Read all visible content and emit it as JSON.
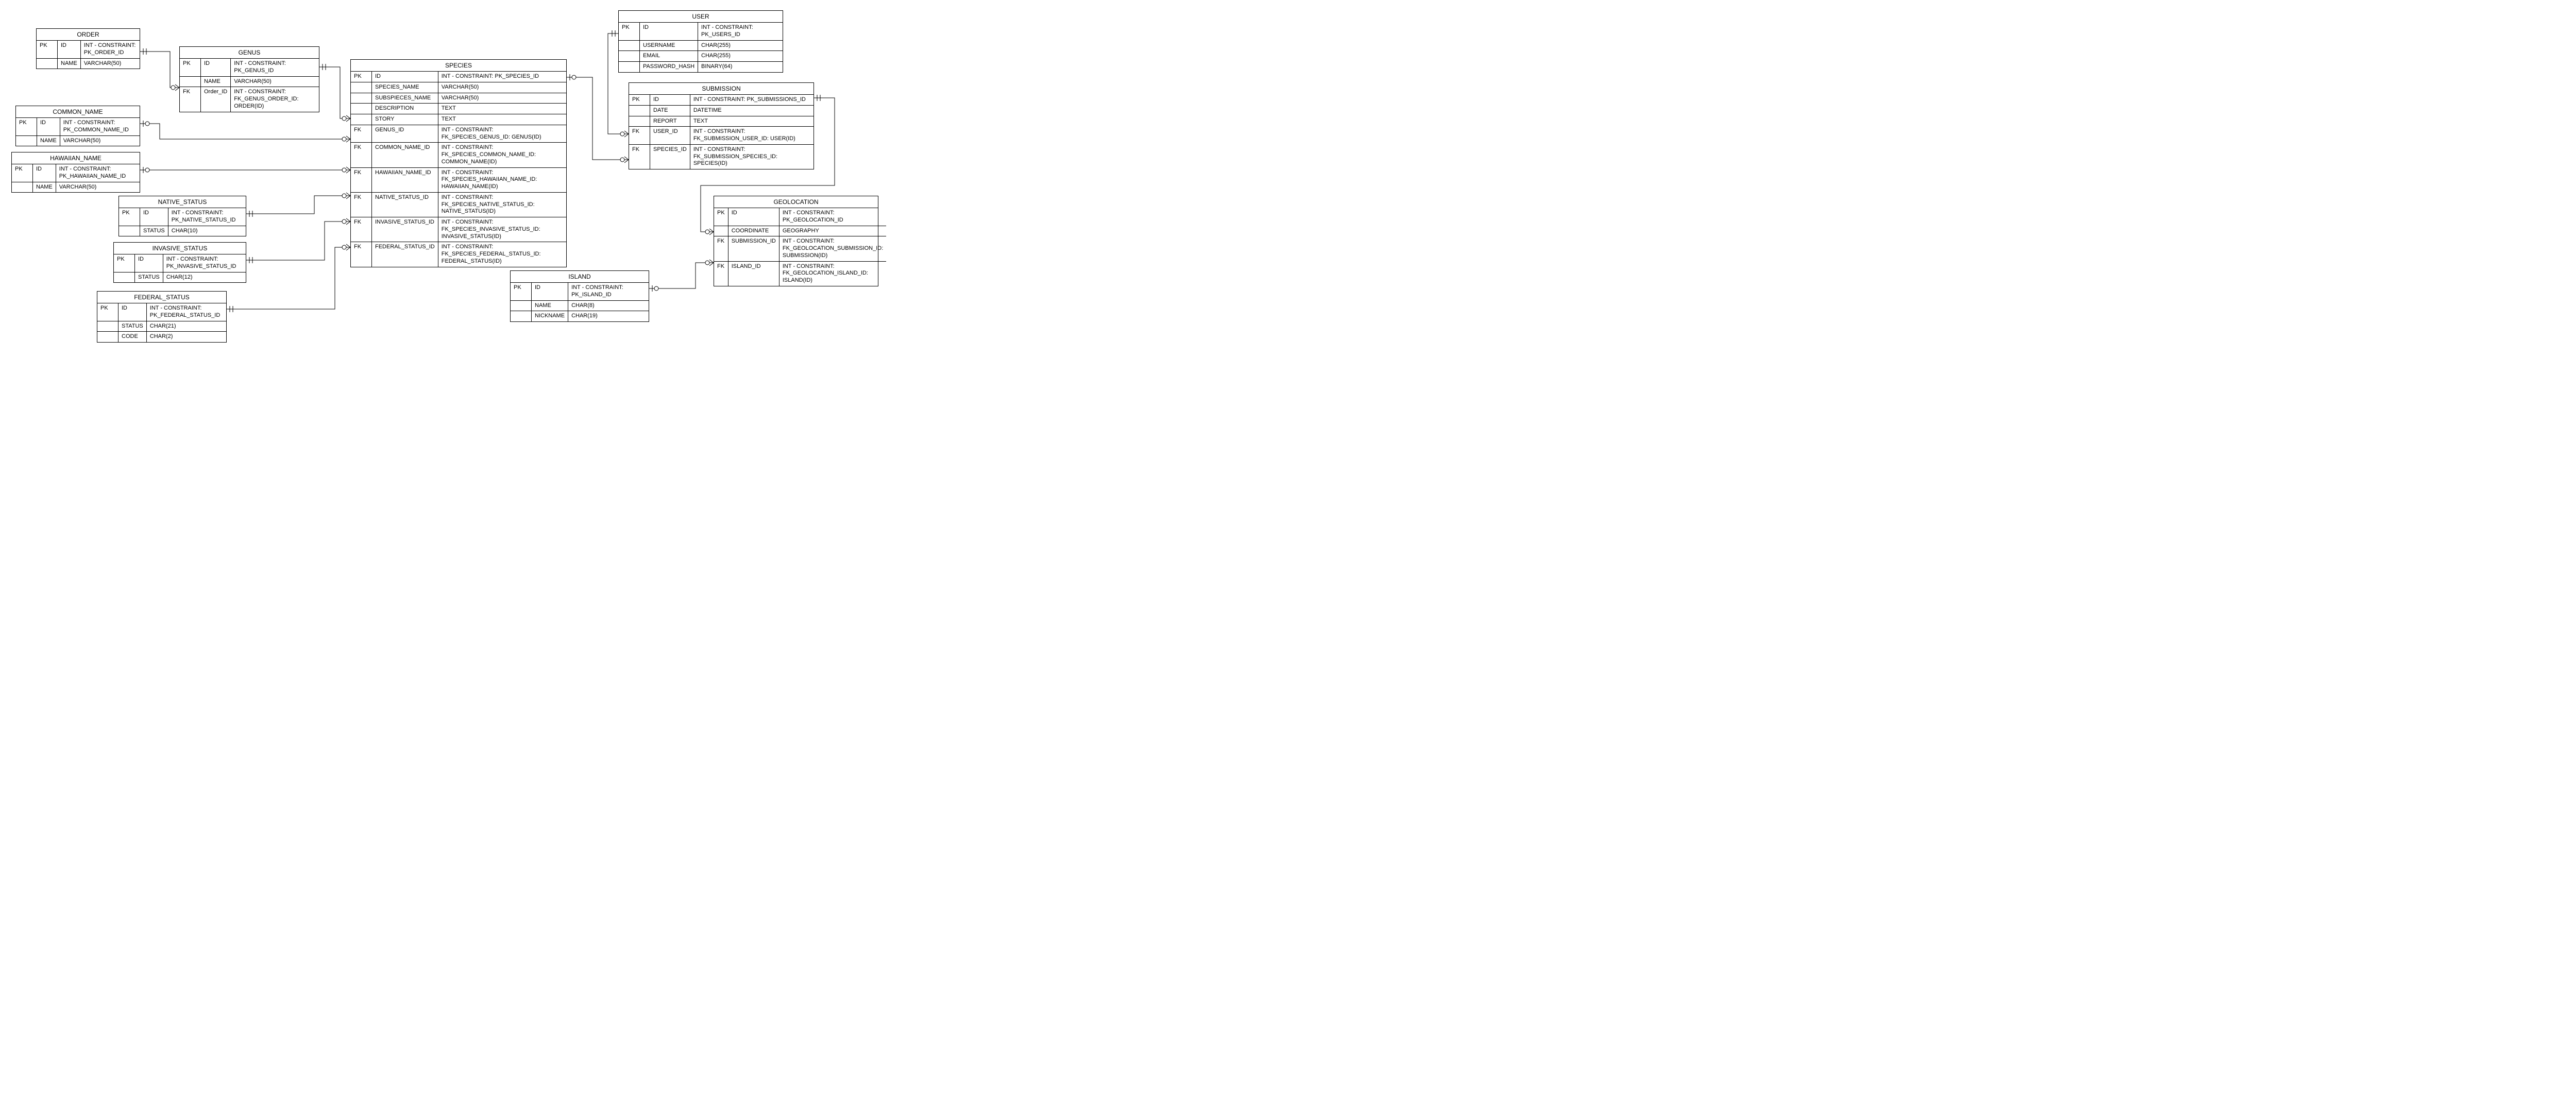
{
  "entities": {
    "order": {
      "title": "ORDER",
      "rows": [
        {
          "key": "PK",
          "name": "ID",
          "type": "INT - CONSTRAINT: PK_ORDER_ID"
        },
        {
          "key": "",
          "name": "NAME",
          "type": "VARCHAR(50)"
        }
      ]
    },
    "genus": {
      "title": "GENUS",
      "rows": [
        {
          "key": "PK",
          "name": "ID",
          "type": "INT - CONSTRAINT: PK_GENUS_ID"
        },
        {
          "key": "",
          "name": "NAME",
          "type": "VARCHAR(50)"
        },
        {
          "key": "FK",
          "name": "Order_ID",
          "type": "INT - CONSTRAINT: FK_GENUS_ORDER_ID: ORDER(ID)"
        }
      ]
    },
    "common_name": {
      "title": "COMMON_NAME",
      "rows": [
        {
          "key": "PK",
          "name": "ID",
          "type": "INT - CONSTRAINT: PK_COMMON_NAME_ID"
        },
        {
          "key": "",
          "name": "NAME",
          "type": "VARCHAR(50)"
        }
      ]
    },
    "hawaiian_name": {
      "title": "HAWAIIAN_NAME",
      "rows": [
        {
          "key": "PK",
          "name": "ID",
          "type": "INT - CONSTRAINT: PK_HAWAIIAN_NAME_ID"
        },
        {
          "key": "",
          "name": "NAME",
          "type": "VARCHAR(50)"
        }
      ]
    },
    "native_status": {
      "title": "NATIVE_STATUS",
      "rows": [
        {
          "key": "PK",
          "name": "ID",
          "type": "INT - CONSTRAINT: PK_NATIVE_STATUS_ID"
        },
        {
          "key": "",
          "name": "STATUS",
          "type": "CHAR(10)"
        }
      ]
    },
    "invasive_status": {
      "title": "INVASIVE_STATUS",
      "rows": [
        {
          "key": "PK",
          "name": "ID",
          "type": "INT - CONSTRAINT: PK_INVASIVE_STATUS_ID"
        },
        {
          "key": "",
          "name": "STATUS",
          "type": "CHAR(12)"
        }
      ]
    },
    "federal_status": {
      "title": "FEDERAL_STATUS",
      "rows": [
        {
          "key": "PK",
          "name": "ID",
          "type": "INT - CONSTRAINT: PK_FEDERAL_STATUS_ID"
        },
        {
          "key": "",
          "name": "STATUS",
          "type": "CHAR(21)"
        },
        {
          "key": "",
          "name": "CODE",
          "type": "CHAR(2)"
        }
      ]
    },
    "species": {
      "title": "SPECIES",
      "rows": [
        {
          "key": "PK",
          "name": "ID",
          "type": "INT - CONSTRAINT: PK_SPECIES_ID"
        },
        {
          "key": "",
          "name": "SPECIES_NAME",
          "type": "VARCHAR(50)"
        },
        {
          "key": "",
          "name": "SUBSPIECES_NAME",
          "type": "VARCHAR(50)"
        },
        {
          "key": "",
          "name": "DESCRIPTION",
          "type": "TEXT"
        },
        {
          "key": "",
          "name": "STORY",
          "type": "TEXT"
        },
        {
          "key": "FK",
          "name": "GENUS_ID",
          "type": "INT - CONSTRAINT: FK_SPECIES_GENUS_ID: GENUS(ID)"
        },
        {
          "key": "FK",
          "name": "COMMON_NAME_ID",
          "type": "INT - CONSTRAINT: FK_SPECIES_COMMON_NAME_ID: COMMON_NAME(ID)"
        },
        {
          "key": "FK",
          "name": "HAWAIIAN_NAME_ID",
          "type": "INT - CONSTRAINT: FK_SPECIES_HAWAIIAN_NAME_ID: HAWAIIAN_NAME(ID)"
        },
        {
          "key": "FK",
          "name": "NATIVE_STATUS_ID",
          "type": "INT - CONSTRAINT: FK_SPECIES_NATIVE_STATUS_ID: NATIVE_STATUS(ID)"
        },
        {
          "key": "FK",
          "name": "INVASIVE_STATUS_ID",
          "type": "INT - CONSTRAINT: FK_SPECIES_INVASIVE_STATUS_ID: INVASIVE_STATUS(ID)"
        },
        {
          "key": "FK",
          "name": "FEDERAL_STATUS_ID",
          "type": "INT - CONSTRAINT: FK_SPECIES_FEDERAL_STATUS_ID: FEDERAL_STATUS(ID)"
        }
      ]
    },
    "user": {
      "title": "USER",
      "rows": [
        {
          "key": "PK",
          "name": "ID",
          "type": "INT - CONSTRAINT: PK_USERS_ID"
        },
        {
          "key": "",
          "name": "USERNAME",
          "type": "CHAR(255)"
        },
        {
          "key": "",
          "name": "EMAIL",
          "type": "CHAR(255)"
        },
        {
          "key": "",
          "name": "PASSWORD_HASH",
          "type": "BINARY(64)"
        }
      ]
    },
    "submission": {
      "title": "SUBMISSION",
      "rows": [
        {
          "key": "PK",
          "name": "ID",
          "type": "INT - CONSTRAINT: PK_SUBMISSIONS_ID"
        },
        {
          "key": "",
          "name": "DATE",
          "type": "DATETIME"
        },
        {
          "key": "",
          "name": "REPORT",
          "type": "TEXT"
        },
        {
          "key": "FK",
          "name": "USER_ID",
          "type": "INT - CONSTRAINT: FK_SUBMISSION_USER_ID: USER(ID)"
        },
        {
          "key": "FK",
          "name": "SPECIES_ID",
          "type": "INT - CONSTRAINT: FK_SUBMISSION_SPECIES_ID: SPECIES(ID)"
        }
      ]
    },
    "geolocation": {
      "title": "GEOLOCATION",
      "rows": [
        {
          "key": "PK",
          "name": "ID",
          "type": "INT - CONSTRAINT: PK_GEOLOCATION_ID"
        },
        {
          "key": "",
          "name": "COORDINATE",
          "type": "GEOGRAPHY"
        },
        {
          "key": "FK",
          "name": "SUBMISSION_ID",
          "type": "INT - CONSTRAINT: FK_GEOLOCATION_SUBMISSION_ID: SUBMISSION(ID)"
        },
        {
          "key": "FK",
          "name": "ISLAND_ID",
          "type": "INT - CONSTRAINT: FK_GEOLOCATION_ISLAND_ID: ISLAND(ID)"
        }
      ]
    },
    "island": {
      "title": "ISLAND",
      "rows": [
        {
          "key": "PK",
          "name": "ID",
          "type": "INT - CONSTRAINT: PK_ISLAND_ID"
        },
        {
          "key": "",
          "name": "NAME",
          "type": "CHAR(8)"
        },
        {
          "key": "",
          "name": "NICKNAME",
          "type": "CHAR(19)"
        }
      ]
    }
  }
}
